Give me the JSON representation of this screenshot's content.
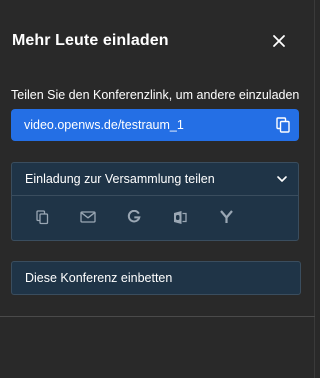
{
  "dialog": {
    "title": "Mehr Leute einladen",
    "close_icon": "close-icon"
  },
  "share": {
    "label": "Teilen Sie den Konferenzlink, um andere einzuladen",
    "link": "video.openws.de/testraum_1",
    "copy_icon": "copy-icon",
    "accent_color": "#246fe5"
  },
  "invite": {
    "header_label": "Einladung zur Versammlung teilen",
    "expand_icon": "chevron-down-icon",
    "options": [
      {
        "icon": "copy-icon"
      },
      {
        "icon": "email-icon"
      },
      {
        "icon": "google-icon"
      },
      {
        "icon": "outlook-icon"
      },
      {
        "icon": "yahoo-icon"
      }
    ]
  },
  "embed": {
    "label": "Diese Konferenz einbetten"
  }
}
